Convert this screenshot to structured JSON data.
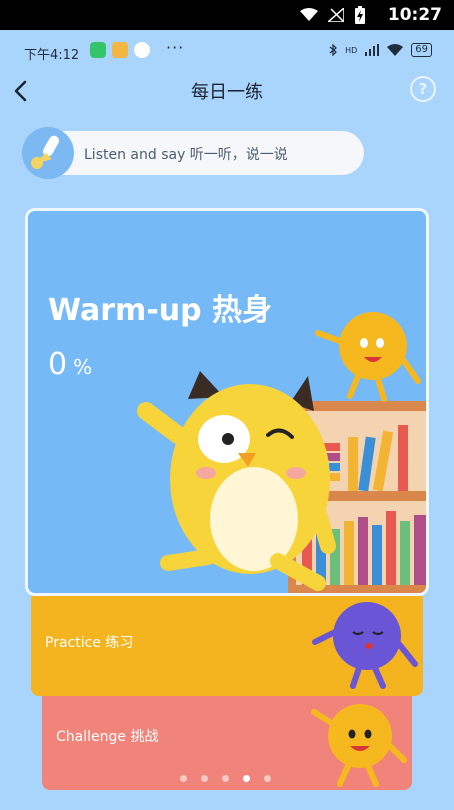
{
  "system_bar": {
    "time": "10:27",
    "icons": [
      "wifi-icon",
      "signal-icon",
      "battery-charging-icon"
    ]
  },
  "phone_status": {
    "time": "下午4:12",
    "more": "···",
    "network": "HD",
    "battery": "69"
  },
  "nav": {
    "title": "每日一练",
    "help_label": "?"
  },
  "instruction": {
    "text": "Listen and say 听一听，说一说"
  },
  "cards": {
    "warmup": {
      "title": "Warm-up 热身",
      "progress_value": "0",
      "progress_unit": "%"
    },
    "practice": {
      "title": "Practice 练习"
    },
    "challenge": {
      "title": "Challenge 挑战"
    }
  },
  "pager": {
    "count": 5,
    "active_index": 3
  },
  "colors": {
    "bg": "#a9d4fb",
    "warmup": "#75b9f7",
    "practice": "#f3b41f",
    "challenge": "#f0847a"
  }
}
